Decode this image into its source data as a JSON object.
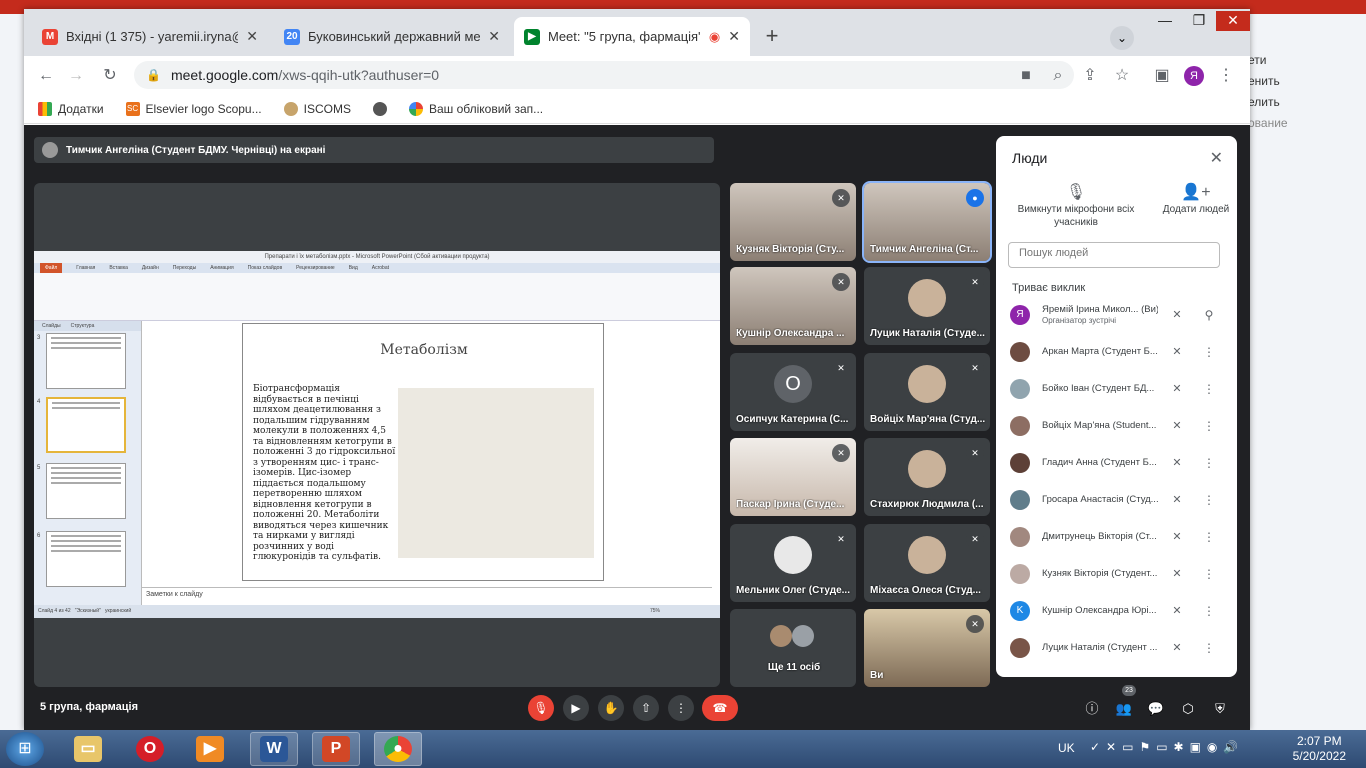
{
  "backdrop": {
    "ribbon_items": [
      "ети",
      "енить",
      "елить",
      "ование"
    ]
  },
  "browser": {
    "tabs": [
      {
        "label": "Вхідні (1 375) - yaremii.iryna@bs",
        "icon": "gmail-icon",
        "favicon_char": "M",
        "favicon_color": "#ea4335"
      },
      {
        "label": "Буковинський державний меди",
        "icon": "calendar-icon",
        "favicon_char": "20",
        "favicon_color": "#4285f4"
      },
      {
        "label": "Meet: \"5 група, фармація\"",
        "icon": "meet-icon",
        "favicon_char": "",
        "favicon_color": "#00832d",
        "active": true
      }
    ],
    "url": {
      "host": "meet.google.com",
      "path": "/xws-qqih-utk?authuser=0"
    },
    "profile_initial": "Я",
    "profile_color": "#8e24aa",
    "bookmarks": [
      {
        "label": "Додатки",
        "icon": "apps-grid-icon"
      },
      {
        "label": "Elsevier logo Scopu...",
        "icon": "scopus-icon",
        "favicon_text": "SC"
      },
      {
        "label": "ISCOMS",
        "icon": "iscoms-icon"
      },
      {
        "label": "",
        "icon": "globe-icon"
      },
      {
        "label": "Ваш обліковий зап...",
        "icon": "google-icon"
      }
    ]
  },
  "meet": {
    "presenter_banner": "Тимчик Ангеліна (Студент БДМУ. Чернівці) на екрані",
    "meeting_name": "5 група, фармація",
    "participant_count": "23",
    "shared_screen": {
      "window_title": "Препарати і їх метаболізм.pptx - Microsoft PowerPoint (Сбой активации продукта)",
      "menu": [
        "Файл",
        "Главная",
        "Вставка",
        "Дизайн",
        "Переходы",
        "Анимация",
        "Показ слайдов",
        "Рецензирование",
        "Вид",
        "Acrobat"
      ],
      "slide_tabs": [
        "Слайды",
        "Структура"
      ],
      "slide_numbers": [
        "3",
        "4",
        "5",
        "6"
      ],
      "slide_title": "Метаболізм",
      "slide_text": "Біотрансформація відбувається в печінці шляхом деацетилювання з подальшим гідруванням молекули в положеннях 4,5 та відновленням кетогрупи в положенні 3 до гідроксильної з утворенням цис- і транс-ізомерів. Цис-ізомер піддається подальшому перетворенню шляхом відновлення кетогрупи в положенні 20. Метаболіти виводяться через кишечник та нирками у вигляді розчинних у воді глюкуронідів та сульфатів.",
      "notes": "Заметки к слайду",
      "status_left": "Слайд 4 из 42",
      "status_theme": "\"Эскизный\"",
      "status_lang": "украинский",
      "zoom": "75%"
    },
    "tiles": [
      {
        "name": "Кузняк Вікторія (Сту...",
        "type": "video",
        "muted": true
      },
      {
        "name": "Тимчик Ангеліна (Ст...",
        "type": "video",
        "muted": false,
        "speaking": true
      },
      {
        "name": "Кушнір Олександра ...",
        "type": "video",
        "muted": true
      },
      {
        "name": "Луцик Наталія (Студе...",
        "type": "avatar",
        "muted": true
      },
      {
        "name": "Осипчук Катерина (С...",
        "type": "letter",
        "letter": "О",
        "muted": true
      },
      {
        "name": "Войціх Мар'яна (Студ...",
        "type": "avatar",
        "muted": true
      },
      {
        "name": "Паскар Ірина (Студе...",
        "type": "video",
        "muted": true
      },
      {
        "name": "Стахирюк Людмила (...",
        "type": "avatar",
        "muted": true
      },
      {
        "name": "Мельник Олег (Студе...",
        "type": "avatar",
        "muted": true
      },
      {
        "name": "Міхаєса Олеся (Студ...",
        "type": "avatar",
        "muted": true
      },
      {
        "name": "Ще 11 осіб",
        "type": "more",
        "muted": false
      },
      {
        "name": "Ви",
        "type": "video",
        "muted": true
      }
    ],
    "people_panel": {
      "title": "Люди",
      "mute_all": "Вимкнути мікрофони всіх учасників",
      "add_people": "Додати людей",
      "search_placeholder": "Пошук людей",
      "section": "Триває виклик",
      "participants": [
        {
          "name": "Яремій Ірина Микол... (Ви)",
          "sub": "Організатор зустрічі",
          "initial": "Я",
          "color": "#8e24aa",
          "action": "pin-icon"
        },
        {
          "name": "Аркан Марта (Студент Б...",
          "initial": "",
          "color": "#6d4c41",
          "action": "more-vert-icon"
        },
        {
          "name": "Бойко Іван (Студент БД...",
          "initial": "",
          "color": "#90a4ae",
          "action": "more-vert-icon"
        },
        {
          "name": "Войціх Мар'яна (Student...",
          "initial": "",
          "color": "#8d6e63",
          "action": "more-vert-icon"
        },
        {
          "name": "Гладич Анна (Студент Б...",
          "initial": "",
          "color": "#5d4037",
          "action": "more-vert-icon"
        },
        {
          "name": "Гросара Анастасія (Студ...",
          "initial": "",
          "color": "#607d8b",
          "action": "more-vert-icon"
        },
        {
          "name": "Дмитрунець Вікторія (Ст...",
          "initial": "",
          "color": "#a1887f",
          "action": "more-vert-icon"
        },
        {
          "name": "Кузняк Вікторія (Студент...",
          "initial": "",
          "color": "#bcaaa4",
          "action": "more-vert-icon"
        },
        {
          "name": "Кушнір Олександра Юрі...",
          "initial": "K",
          "color": "#1e88e5",
          "action": "more-vert-icon"
        },
        {
          "name": "Луцик Наталія (Студент ...",
          "initial": "",
          "color": "#795548",
          "action": "more-vert-icon"
        }
      ]
    }
  },
  "taskbar": {
    "apps": [
      "explorer-icon",
      "opera-icon",
      "media-player-icon",
      "word-icon",
      "powerpoint-icon",
      "chrome-icon"
    ],
    "lang": "UK",
    "time": "2:07 PM",
    "date": "5/20/2022"
  }
}
